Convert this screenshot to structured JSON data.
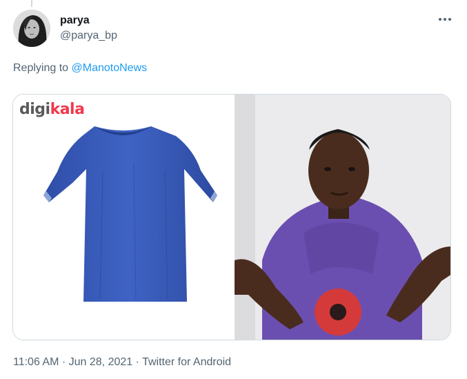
{
  "tweet": {
    "display_name": "parya",
    "handle": "@parya_bp",
    "reply_prefix": "Replying to",
    "reply_to": "@ManotoNews",
    "time": "11:06 AM",
    "separator": " · ",
    "date": "Jun 28, 2021",
    "source": "Twitter for Android",
    "more_icon": "more-horizontal-icon"
  },
  "media": {
    "left_image": {
      "logo_part1": "digi",
      "logo_part2": "kala",
      "logo_colors": {
        "digi": "#5a5a5a",
        "kala": "#ef394e"
      },
      "subject": "blue medical gown"
    },
    "right_image": {
      "subject": "man in purple hoodie shrugging with open palms"
    }
  },
  "colors": {
    "text_primary": "#0f1419",
    "text_secondary": "#536471",
    "link": "#1d9bf0",
    "border": "#cfd9de"
  }
}
